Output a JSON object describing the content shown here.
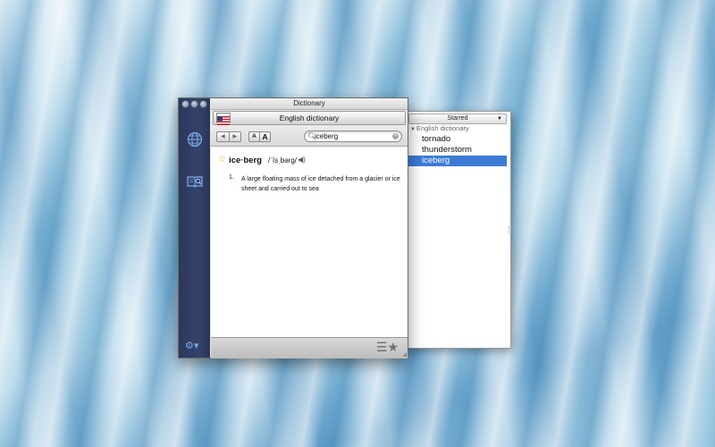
{
  "window": {
    "title": "Dictionary"
  },
  "source": {
    "label": "English dictionary"
  },
  "toolbar": {
    "back_icon": "back-arrow",
    "forward_icon": "forward-arrow",
    "font_smaller": "A",
    "font_larger": "A",
    "search_value": "iceberg"
  },
  "entry": {
    "headword": "ice·berg",
    "pronunciation": "/ˈīsˌbərg/",
    "definition_number": "1.",
    "definition": "A large floating mass of ice detached from a glacier or ice sheet and carried out to sea"
  },
  "drawer": {
    "header": "Starred",
    "group": "English dictionary",
    "items": [
      {
        "label": "tornado",
        "selected": false
      },
      {
        "label": "thunderstorm",
        "selected": false
      },
      {
        "label": "iceberg",
        "selected": true
      }
    ]
  },
  "colors": {
    "selection": "#3b7bd6",
    "sidebar": "#2f3b61",
    "star": "#c4b10c"
  }
}
